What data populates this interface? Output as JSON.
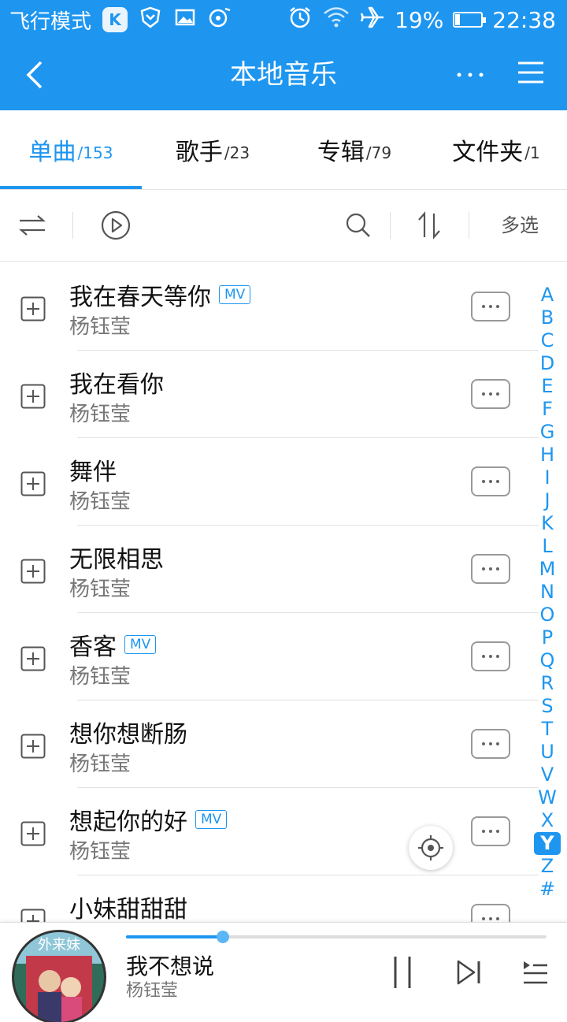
{
  "status_bar": {
    "left_text": "飞行模式",
    "k_badge": "K",
    "battery": "19%",
    "battery_level": 0.19,
    "time": "22:38"
  },
  "header": {
    "title": "本地音乐"
  },
  "tabs": [
    {
      "label": "单曲",
      "count": "/153",
      "active": true
    },
    {
      "label": "歌手",
      "count": "/23",
      "active": false
    },
    {
      "label": "专辑",
      "count": "/79",
      "active": false
    },
    {
      "label": "文件夹",
      "count": "/1",
      "active": false
    }
  ],
  "toolbar": {
    "multi_select_label": "多选"
  },
  "songs": [
    {
      "title": "我在春天等你",
      "artist": "杨钰莹",
      "mv": "MV"
    },
    {
      "title": "我在看你",
      "artist": "杨钰莹",
      "mv": ""
    },
    {
      "title": "舞伴",
      "artist": "杨钰莹",
      "mv": ""
    },
    {
      "title": "无限相思",
      "artist": "杨钰莹",
      "mv": ""
    },
    {
      "title": "香客",
      "artist": "杨钰莹",
      "mv": "MV"
    },
    {
      "title": "想你想断肠",
      "artist": "杨钰莹",
      "mv": ""
    },
    {
      "title": "想起你的好",
      "artist": "杨钰莹",
      "mv": "MV"
    },
    {
      "title": "小妹甜甜甜",
      "artist": "",
      "mv": ""
    }
  ],
  "index_letters": [
    "A",
    "B",
    "C",
    "D",
    "E",
    "F",
    "G",
    "H",
    "I",
    "J",
    "K",
    "L",
    "M",
    "N",
    "O",
    "P",
    "Q",
    "R",
    "S",
    "T",
    "U",
    "V",
    "W",
    "X",
    "Y",
    "Z",
    "#"
  ],
  "index_active": "Y",
  "now_playing": {
    "title": "我不想说",
    "artist": "杨钰莹",
    "progress": 0.23
  },
  "colors": {
    "accent": "#1e96f0"
  }
}
